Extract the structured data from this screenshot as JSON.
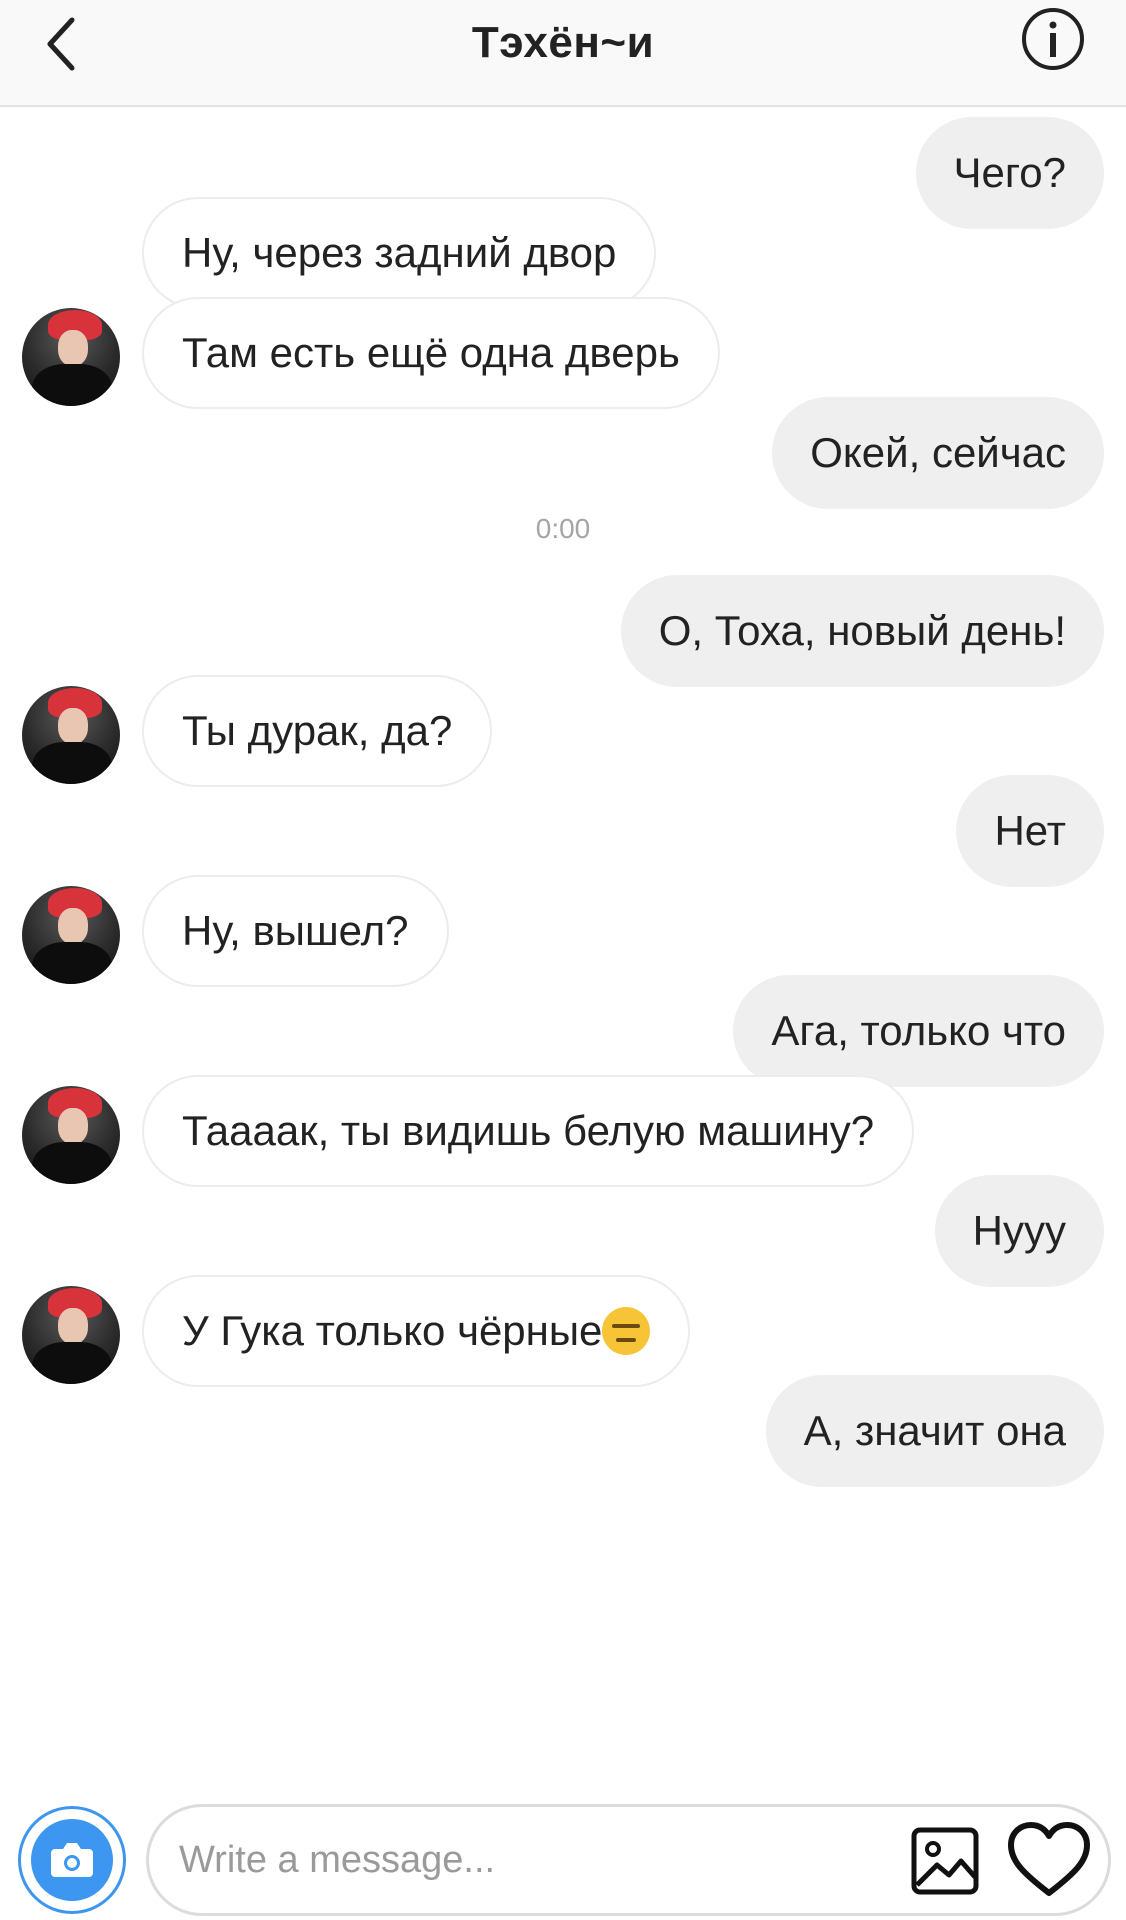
{
  "header": {
    "title": "Тэхён~и",
    "back_icon": "chevron-left-icon",
    "info_icon": "info-icon"
  },
  "messages": [
    {
      "dir": "out",
      "text": "Чего?"
    },
    {
      "dir": "in",
      "text": "Ну, через задний двор"
    },
    {
      "dir": "in",
      "text": "Там есть ещё одна дверь"
    },
    {
      "dir": "out",
      "text": "Окей, сейчас"
    },
    {
      "dir": "time",
      "text": "0:00"
    },
    {
      "dir": "out",
      "text": "О, Тоха, новый день!"
    },
    {
      "dir": "in",
      "text": "Ты дурак, да?"
    },
    {
      "dir": "out",
      "text": "Нет"
    },
    {
      "dir": "in",
      "text": "Ну, вышел?"
    },
    {
      "dir": "out",
      "text": "Ага, только что"
    },
    {
      "dir": "in",
      "text": "Таааак, ты видишь белую машину?"
    },
    {
      "dir": "out",
      "text": "Нууу"
    },
    {
      "dir": "in",
      "text": "У Гука только чёрные",
      "emoji": "expressionless-face-emoji"
    },
    {
      "dir": "out",
      "text": "А, значит она"
    }
  ],
  "composer": {
    "placeholder": "Write a message...",
    "value": "",
    "camera_icon": "camera-icon",
    "gallery_icon": "image-gallery-icon",
    "like_icon": "heart-icon"
  },
  "colors": {
    "accent": "#3d96f0",
    "outgoing_bubble": "#efefef",
    "incoming_border": "#ececec",
    "timestamp": "#a5a5a5"
  }
}
